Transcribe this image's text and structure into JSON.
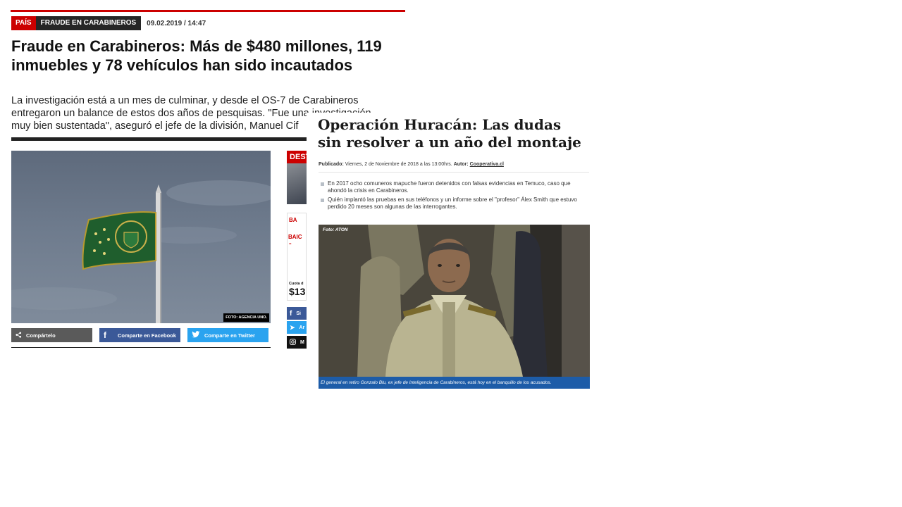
{
  "article_left": {
    "tag_section": "PAÍS",
    "tag_topic": "FRAUDE EN CARABINEROS",
    "date": "09.02.2019 / 14:47",
    "title": "Fraude en Carabineros: Más de $480 millones, 119 inmuebles y 78 vehículos han sido incautados",
    "lead": "La investigación está a un mes de culminar, y desde el OS-7 de Carabineros entregaron un balance de estos dos años de pesquisas. \"Fue una investigación muy bien sustentada\", aseguró el jefe de la división, Manuel Cif",
    "photo_credit": "FOTO: AGENCIA UNO.",
    "share": {
      "generic": "Compártelo",
      "facebook": "Comparte en Facebook",
      "twitter": "Comparte en Twitter"
    },
    "sidebar": {
      "heading": "DEST",
      "ad_brand": "BA",
      "ad_logo": "BAIC",
      "ad_tag": "=",
      "ad_cuota": "Cuota d",
      "ad_price": "$13",
      "social": [
        {
          "name": "facebook",
          "label": "Si",
          "color": "#3b5998"
        },
        {
          "name": "twitter",
          "label": "Ar",
          "color": "#2aa3ef"
        },
        {
          "name": "instagram",
          "label": "M",
          "color": "#111111"
        }
      ]
    }
  },
  "article_right": {
    "title": "Operación Huracán: Las dudas sin resolver a un año del montaje",
    "meta_prefix": "Publicado:",
    "meta_date": "Viernes, 2 de Noviembre de 2018 a las 13:00hrs.",
    "meta_author_prefix": "Autor:",
    "meta_author": "Cooperativa.cl",
    "bullets": [
      "En 2017 ocho comuneros mapuche fueron detenidos con falsas evidencias en Temuco, caso que ahondó la crisis en Carabineros.",
      "Quién implantó las pruebas en sus teléfonos y un informe sobre el \"profesor\" Álex Smith que estuvo perdido 20 meses son algunas de las interrogantes."
    ],
    "photo_label": "Foto: ATON",
    "photo_caption": "El general en retiro Gonzalo Blu, ex jefe de Inteligencia de Carabineros, está hoy en el banquillo de los acusados."
  },
  "colors": {
    "red_accent": "#cc0000",
    "facebook": "#3b5998",
    "twitter": "#2aa3ef",
    "caption_blue": "#1d5ca8"
  }
}
